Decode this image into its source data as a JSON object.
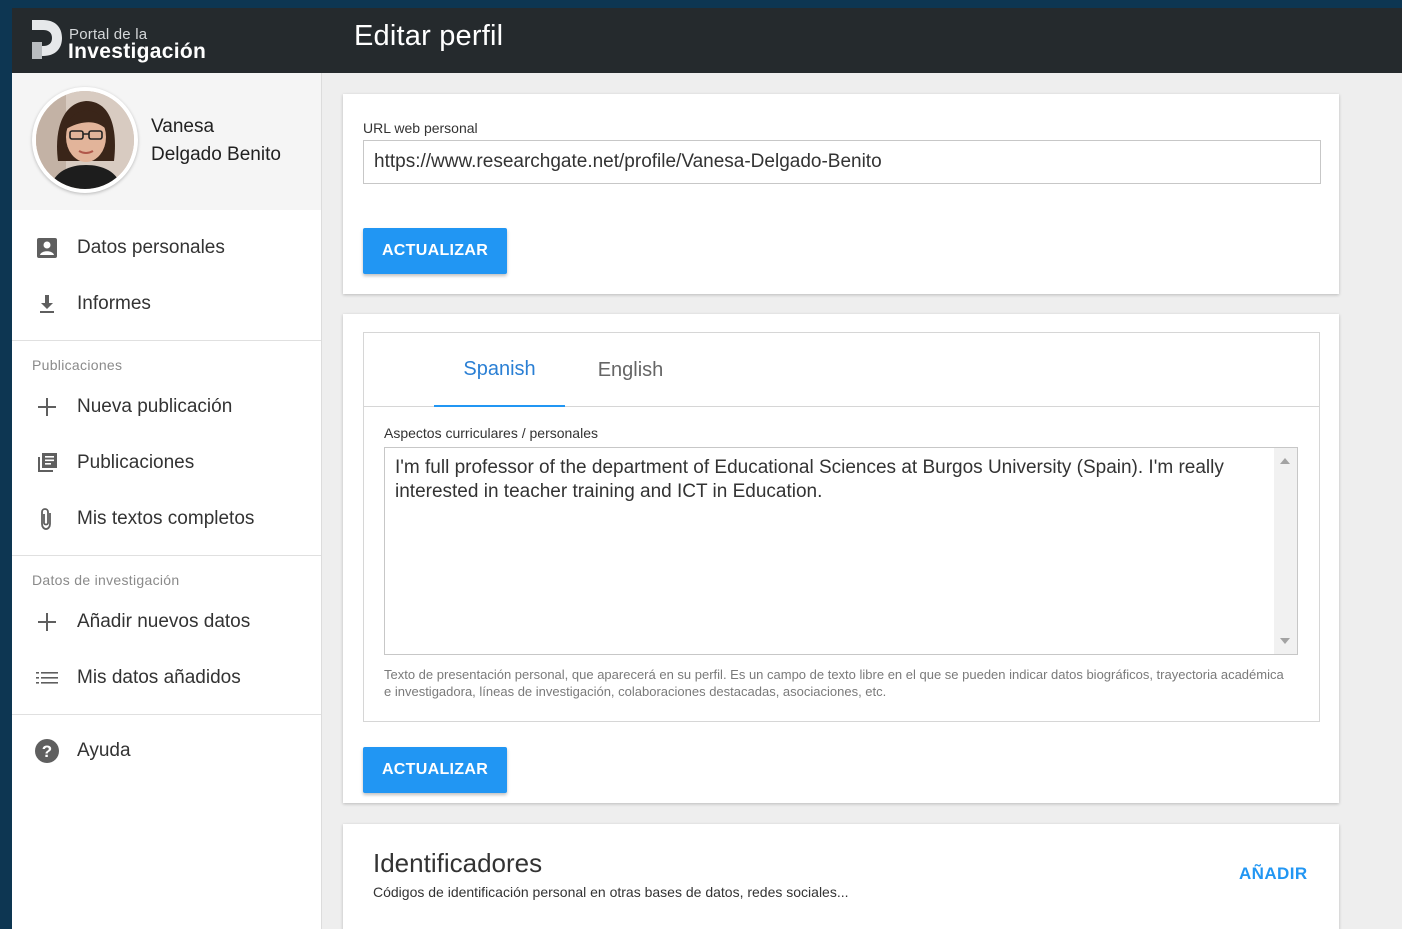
{
  "header": {
    "logo_small": "Portal de la",
    "logo_big": "Investigación",
    "page_title": "Editar perfil"
  },
  "sidebar": {
    "profile": {
      "first_name": "Vanesa",
      "last_name": "Delgado Benito"
    },
    "items_main": [
      {
        "label": "Datos personales",
        "icon": "person-card-icon"
      },
      {
        "label": "Informes",
        "icon": "download-icon"
      }
    ],
    "publicaciones_header": "Publicaciones",
    "items_pub": [
      {
        "label": "Nueva publicación",
        "icon": "plus-icon"
      },
      {
        "label": "Publicaciones",
        "icon": "library-icon"
      },
      {
        "label": "Mis textos completos",
        "icon": "paperclip-icon"
      }
    ],
    "datos_header": "Datos de investigación",
    "items_datos": [
      {
        "label": "Añadir nuevos datos",
        "icon": "plus-icon"
      },
      {
        "label": "Mis datos añadidos",
        "icon": "list-icon"
      }
    ],
    "help": {
      "label": "Ayuda",
      "icon": "help-circle-icon"
    }
  },
  "url_card": {
    "label": "URL web personal",
    "value": "https://www.researchgate.net/profile/Vanesa-Delgado-Benito",
    "button": "ACTUALIZAR"
  },
  "bio_card": {
    "tabs": [
      "Spanish",
      "English"
    ],
    "active_tab": "Spanish",
    "label": "Aspectos curriculares / personales",
    "value": "I'm full professor of the department of Educational Sciences at Burgos University (Spain). I'm really interested in teacher training and ICT in Education.",
    "helper": "Texto de presentación personal, que aparecerá en su perfil. Es un campo de texto libre en el que se pueden indicar datos biográficos, trayectoria académica e investigadora, líneas de investigación, colaboraciones destacadas, asociaciones, etc.",
    "button": "ACTUALIZAR"
  },
  "ident_card": {
    "title": "Identificadores",
    "subtitle": "Códigos de identificación personal en otras bases de datos, redes sociales...",
    "add": "AÑADIR"
  },
  "colors": {
    "topbar": "#252a2d",
    "accent": "#2196f3",
    "frame": "#0d3652"
  }
}
